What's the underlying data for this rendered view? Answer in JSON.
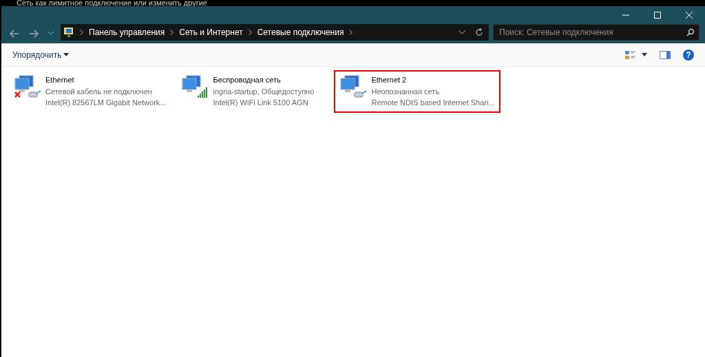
{
  "background_text": "Сеть как лимитное подключение или изменить другие",
  "breadcrumb": [
    "Панель управления",
    "Сеть и Интернет",
    "Сетевые подключения"
  ],
  "search": {
    "placeholder": "Поиск: Сетевые подключения"
  },
  "toolbar": {
    "organize": "Упорядочить",
    "help": "?"
  },
  "connections": [
    {
      "name": "Ethernet",
      "status": "Сетевой кабель не подключен",
      "adapter": "Intel(R) 82567LM Gigabit Network...",
      "kind": "wired",
      "disconnected": true,
      "highlighted": false
    },
    {
      "name": "Беспроводная сеть",
      "status": "ingria-startup, Общедоступно",
      "adapter": "Intel(R) WiFi Link 5100 AGN",
      "kind": "wireless",
      "disconnected": false,
      "highlighted": false
    },
    {
      "name": "Ethernet 2",
      "status": "Неопознанная сеть",
      "adapter": "Remote NDIS based Internet Shari...",
      "kind": "wired",
      "disconnected": false,
      "highlighted": true
    }
  ]
}
